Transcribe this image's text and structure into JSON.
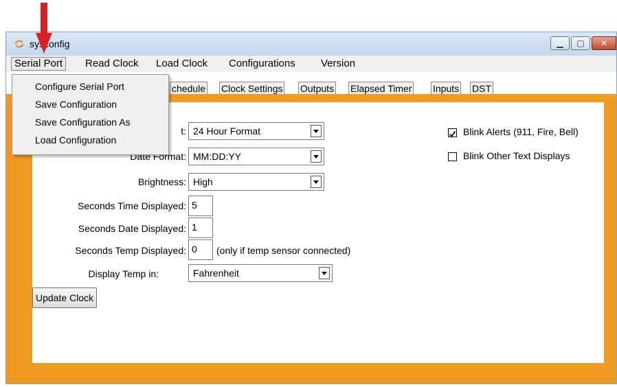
{
  "window": {
    "title": "sysconfig",
    "controls": {
      "minimize": "▁",
      "maximize": "▢",
      "close": "✕"
    }
  },
  "menubar": {
    "items": [
      "Serial Port",
      "Read Clock",
      "Load Clock",
      "Configurations",
      "Version"
    ]
  },
  "serial_menu": {
    "items": [
      "Configure Serial Port",
      "Save Configuration",
      "Save Configuration As",
      "Load Configuration"
    ]
  },
  "tabs": [
    "chedule",
    "Clock Settings",
    "Outputs",
    "Elapsed Timer",
    "Inputs",
    "DST"
  ],
  "settings": {
    "time_format": {
      "label": "t:",
      "value": "24 Hour Format"
    },
    "date_format": {
      "label": "Date Format:",
      "value": "MM:DD:YY"
    },
    "brightness": {
      "label": "Brightness:",
      "value": "High"
    },
    "seconds_time": {
      "label": "Seconds Time Displayed:",
      "value": "5"
    },
    "seconds_date": {
      "label": "Seconds Date Displayed:",
      "value": "1"
    },
    "seconds_temp": {
      "label": "Seconds Temp Displayed:",
      "value": "0",
      "hint": "(only if temp sensor connected)"
    },
    "temp_unit": {
      "label": "Display Temp in:",
      "value": "Fahrenheit"
    }
  },
  "checkboxes": [
    {
      "label": "Blink Alerts (911, Fire, Bell)",
      "checked": true
    },
    {
      "label": "Blink Other Text Displays",
      "checked": false
    }
  ],
  "buttons": {
    "update": "Update Clock"
  },
  "colors": {
    "frame": "#f09a22",
    "arrow": "#d8202a",
    "app_icon": "#f28a1e"
  }
}
